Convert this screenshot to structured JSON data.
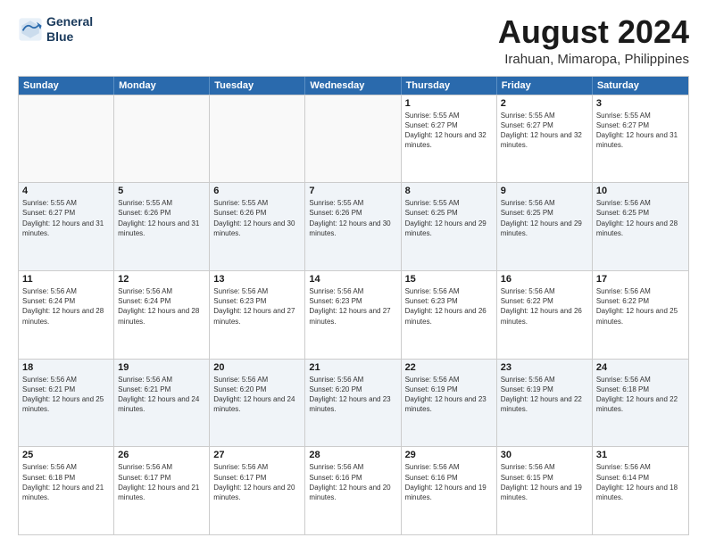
{
  "app": {
    "logo_line1": "General",
    "logo_line2": "Blue"
  },
  "header": {
    "title": "August 2024",
    "subtitle": "Irahuan, Mimaropa, Philippines"
  },
  "calendar": {
    "days_of_week": [
      "Sunday",
      "Monday",
      "Tuesday",
      "Wednesday",
      "Thursday",
      "Friday",
      "Saturday"
    ],
    "weeks": [
      [
        {
          "day": "",
          "empty": true
        },
        {
          "day": "",
          "empty": true
        },
        {
          "day": "",
          "empty": true
        },
        {
          "day": "",
          "empty": true
        },
        {
          "day": "1",
          "sunrise": "5:55 AM",
          "sunset": "6:27 PM",
          "daylight": "12 hours and 32 minutes."
        },
        {
          "day": "2",
          "sunrise": "5:55 AM",
          "sunset": "6:27 PM",
          "daylight": "12 hours and 32 minutes."
        },
        {
          "day": "3",
          "sunrise": "5:55 AM",
          "sunset": "6:27 PM",
          "daylight": "12 hours and 31 minutes."
        }
      ],
      [
        {
          "day": "4",
          "sunrise": "5:55 AM",
          "sunset": "6:27 PM",
          "daylight": "12 hours and 31 minutes."
        },
        {
          "day": "5",
          "sunrise": "5:55 AM",
          "sunset": "6:26 PM",
          "daylight": "12 hours and 31 minutes."
        },
        {
          "day": "6",
          "sunrise": "5:55 AM",
          "sunset": "6:26 PM",
          "daylight": "12 hours and 30 minutes."
        },
        {
          "day": "7",
          "sunrise": "5:55 AM",
          "sunset": "6:26 PM",
          "daylight": "12 hours and 30 minutes."
        },
        {
          "day": "8",
          "sunrise": "5:55 AM",
          "sunset": "6:25 PM",
          "daylight": "12 hours and 29 minutes."
        },
        {
          "day": "9",
          "sunrise": "5:56 AM",
          "sunset": "6:25 PM",
          "daylight": "12 hours and 29 minutes."
        },
        {
          "day": "10",
          "sunrise": "5:56 AM",
          "sunset": "6:25 PM",
          "daylight": "12 hours and 28 minutes."
        }
      ],
      [
        {
          "day": "11",
          "sunrise": "5:56 AM",
          "sunset": "6:24 PM",
          "daylight": "12 hours and 28 minutes."
        },
        {
          "day": "12",
          "sunrise": "5:56 AM",
          "sunset": "6:24 PM",
          "daylight": "12 hours and 28 minutes."
        },
        {
          "day": "13",
          "sunrise": "5:56 AM",
          "sunset": "6:23 PM",
          "daylight": "12 hours and 27 minutes."
        },
        {
          "day": "14",
          "sunrise": "5:56 AM",
          "sunset": "6:23 PM",
          "daylight": "12 hours and 27 minutes."
        },
        {
          "day": "15",
          "sunrise": "5:56 AM",
          "sunset": "6:23 PM",
          "daylight": "12 hours and 26 minutes."
        },
        {
          "day": "16",
          "sunrise": "5:56 AM",
          "sunset": "6:22 PM",
          "daylight": "12 hours and 26 minutes."
        },
        {
          "day": "17",
          "sunrise": "5:56 AM",
          "sunset": "6:22 PM",
          "daylight": "12 hours and 25 minutes."
        }
      ],
      [
        {
          "day": "18",
          "sunrise": "5:56 AM",
          "sunset": "6:21 PM",
          "daylight": "12 hours and 25 minutes."
        },
        {
          "day": "19",
          "sunrise": "5:56 AM",
          "sunset": "6:21 PM",
          "daylight": "12 hours and 24 minutes."
        },
        {
          "day": "20",
          "sunrise": "5:56 AM",
          "sunset": "6:20 PM",
          "daylight": "12 hours and 24 minutes."
        },
        {
          "day": "21",
          "sunrise": "5:56 AM",
          "sunset": "6:20 PM",
          "daylight": "12 hours and 23 minutes."
        },
        {
          "day": "22",
          "sunrise": "5:56 AM",
          "sunset": "6:19 PM",
          "daylight": "12 hours and 23 minutes."
        },
        {
          "day": "23",
          "sunrise": "5:56 AM",
          "sunset": "6:19 PM",
          "daylight": "12 hours and 22 minutes."
        },
        {
          "day": "24",
          "sunrise": "5:56 AM",
          "sunset": "6:18 PM",
          "daylight": "12 hours and 22 minutes."
        }
      ],
      [
        {
          "day": "25",
          "sunrise": "5:56 AM",
          "sunset": "6:18 PM",
          "daylight": "12 hours and 21 minutes."
        },
        {
          "day": "26",
          "sunrise": "5:56 AM",
          "sunset": "6:17 PM",
          "daylight": "12 hours and 21 minutes."
        },
        {
          "day": "27",
          "sunrise": "5:56 AM",
          "sunset": "6:17 PM",
          "daylight": "12 hours and 20 minutes."
        },
        {
          "day": "28",
          "sunrise": "5:56 AM",
          "sunset": "6:16 PM",
          "daylight": "12 hours and 20 minutes."
        },
        {
          "day": "29",
          "sunrise": "5:56 AM",
          "sunset": "6:16 PM",
          "daylight": "12 hours and 19 minutes."
        },
        {
          "day": "30",
          "sunrise": "5:56 AM",
          "sunset": "6:15 PM",
          "daylight": "12 hours and 19 minutes."
        },
        {
          "day": "31",
          "sunrise": "5:56 AM",
          "sunset": "6:14 PM",
          "daylight": "12 hours and 18 minutes."
        }
      ]
    ]
  }
}
